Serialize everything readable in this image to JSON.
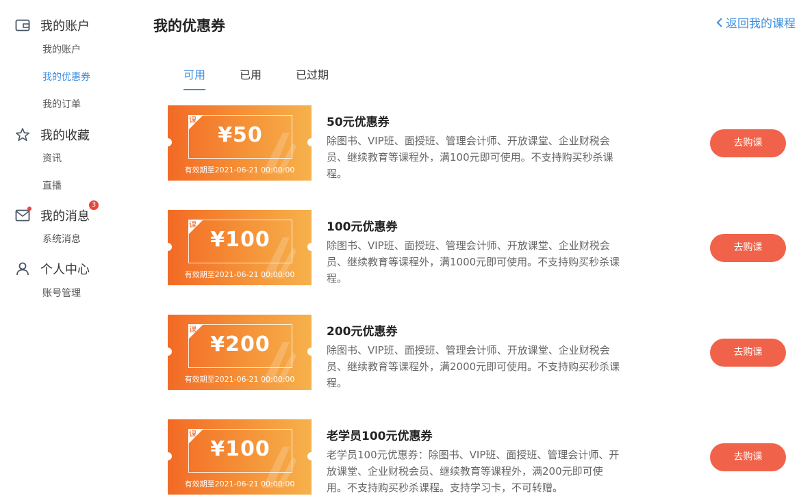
{
  "sidebar": {
    "groups": [
      {
        "label": "我的账户",
        "icon": "wallet-icon",
        "subs": [
          "我的账户",
          "我的优惠券",
          "我的订单"
        ]
      },
      {
        "label": "我的收藏",
        "icon": "star-icon",
        "subs": [
          "资讯",
          "直播"
        ]
      },
      {
        "label": "我的消息",
        "icon": "mail-icon",
        "badge": "3",
        "subs": [
          "系统消息"
        ]
      },
      {
        "label": "个人中心",
        "icon": "user-icon",
        "subs": [
          "账号管理"
        ]
      }
    ],
    "active_sub": "我的优惠券"
  },
  "header": {
    "title": "我的优惠券",
    "back_label": "返回我的课程"
  },
  "tabs": [
    {
      "label": "可用",
      "active": true
    },
    {
      "label": "已用",
      "active": false
    },
    {
      "label": "已过期",
      "active": false
    }
  ],
  "coupons": [
    {
      "tag": "课",
      "amount": "¥50",
      "expiry": "有效期至2021-06-21 00:00:00",
      "title": "50元优惠券",
      "desc": "除图书、VIP班、面授班、管理会计师、开放课堂、企业财税会员、继续教育等课程外，满100元即可使用。不支持购买秒杀课程。",
      "button": "去购课"
    },
    {
      "tag": "课",
      "amount": "¥100",
      "expiry": "有效期至2021-06-21 00:00:00",
      "title": "100元优惠券",
      "desc": "除图书、VIP班、面授班、管理会计师、开放课堂、企业财税会员、继续教育等课程外，满1000元即可使用。不支持购买秒杀课程。",
      "button": "去购课"
    },
    {
      "tag": "课",
      "amount": "¥200",
      "expiry": "有效期至2021-06-21 00:00:00",
      "title": "200元优惠券",
      "desc": "除图书、VIP班、面授班、管理会计师、开放课堂、企业财税会员、继续教育等课程外，满2000元即可使用。不支持购买秒杀课程。",
      "button": "去购课"
    },
    {
      "tag": "课",
      "amount": "¥100",
      "expiry": "有效期至2021-06-21 00:00:00",
      "title": "老学员100元优惠券",
      "desc": "老学员100元优惠券：除图书、VIP班、面授班、管理会计师、开放课堂、企业财税会员、继续教育等课程外，满200元即可使用。不支持购买秒杀课程。支持学习卡，不可转赠。",
      "button": "去购课"
    }
  ],
  "colors": {
    "accent": "#3b8ee0",
    "button": "#f0634a",
    "coupon_start": "#f36a25",
    "coupon_end": "#f6b24c",
    "badge": "#e8453c"
  }
}
